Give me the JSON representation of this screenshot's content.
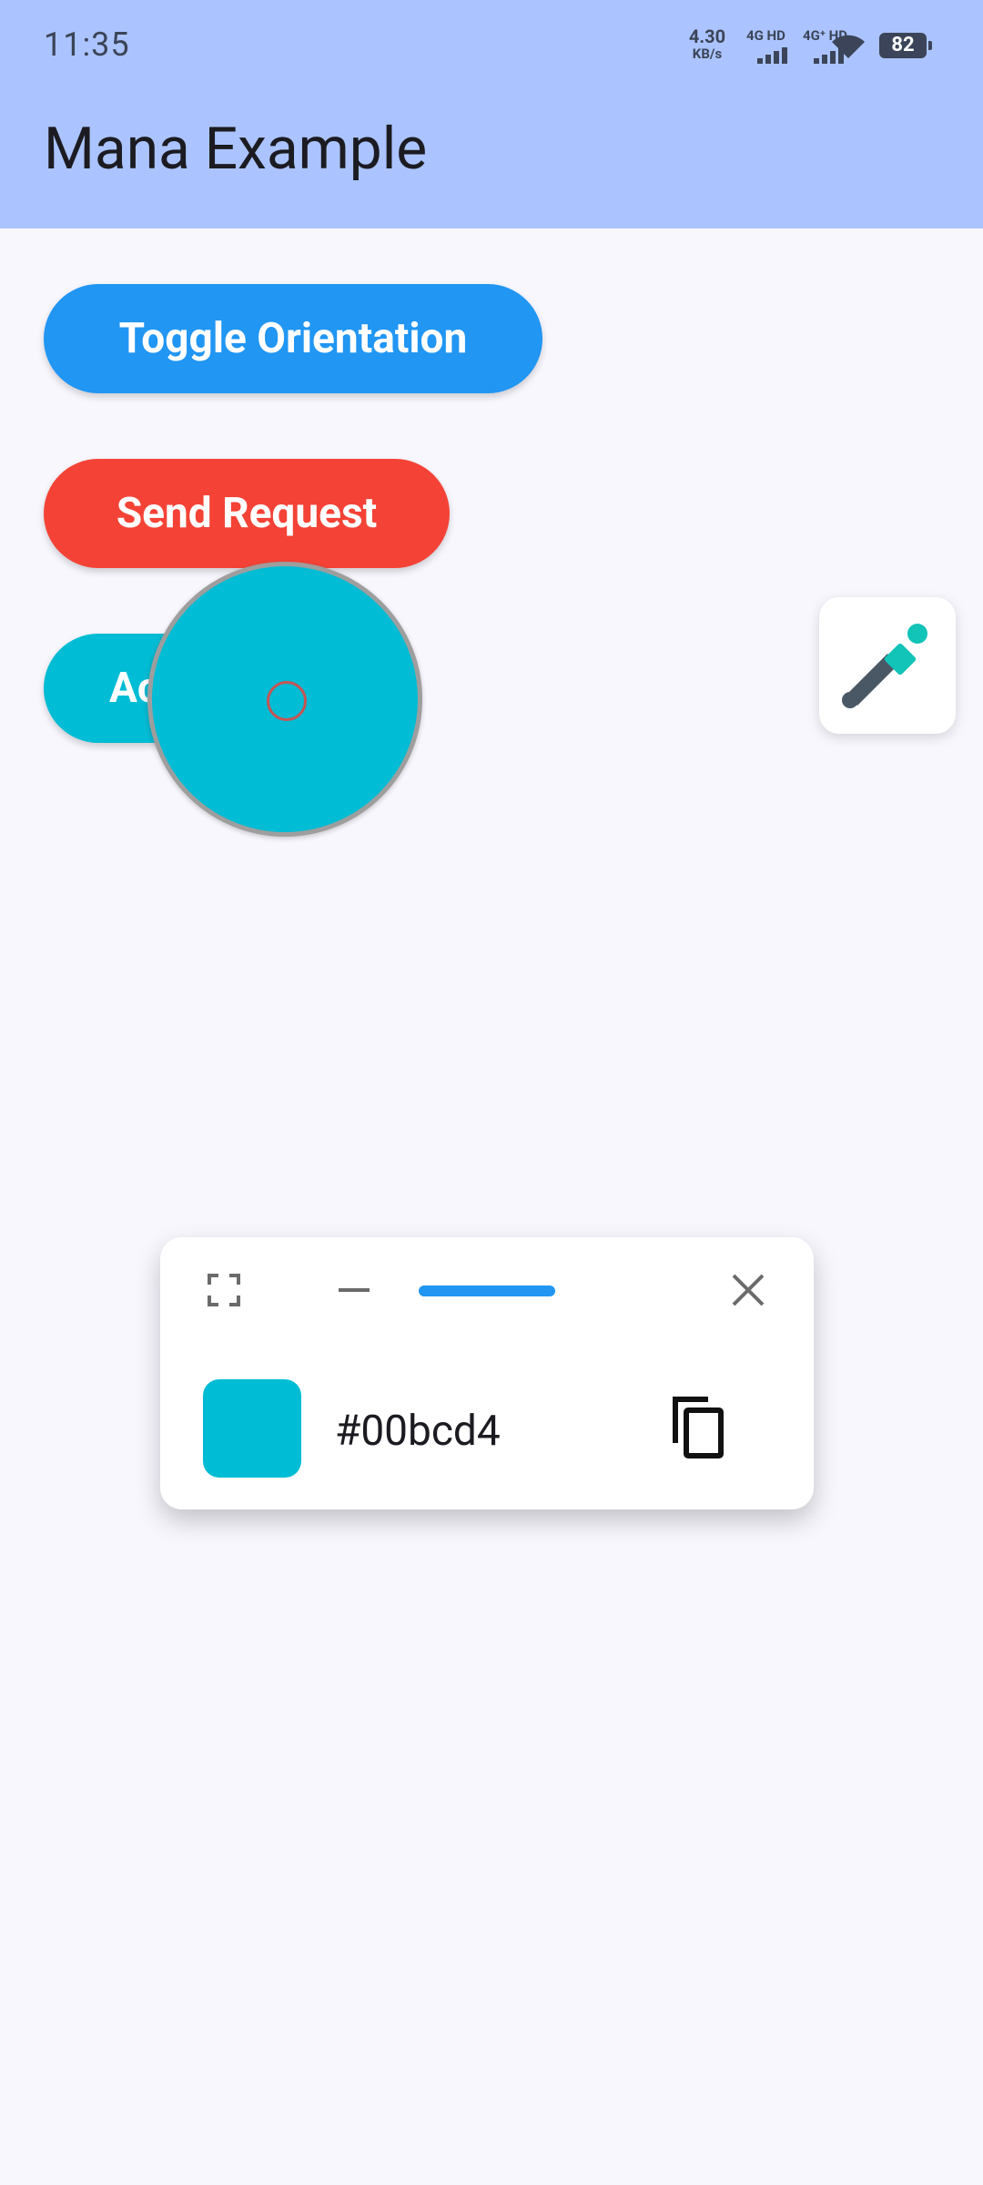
{
  "status_bar": {
    "time": "11:35",
    "net_speed_value": "4.30",
    "net_speed_unit": "KB/s",
    "sim1_label": "4G HD",
    "sim2_label": "4G⁺ HD",
    "battery_level": "82",
    "icons": [
      "signal-icon",
      "signal-icon",
      "wifi-icon",
      "battery-icon"
    ]
  },
  "app_bar": {
    "title": "Mana Example",
    "background_color": "#abc4ff"
  },
  "buttons": {
    "toggle_orientation": "Toggle Orientation",
    "send_request": "Send Request",
    "third_partial": "Ac"
  },
  "colors": {
    "toggle_button": "#2196f3",
    "send_button": "#f44336",
    "third_button": "#00bcd4"
  },
  "color_picker": {
    "fab_icon": "eyedropper-icon",
    "panel_icons": [
      "expand-icon",
      "minimize-icon",
      "close-icon",
      "copy-icon"
    ],
    "selected_hex": "#00bcd4",
    "swatch_color": "#00bcd4"
  }
}
